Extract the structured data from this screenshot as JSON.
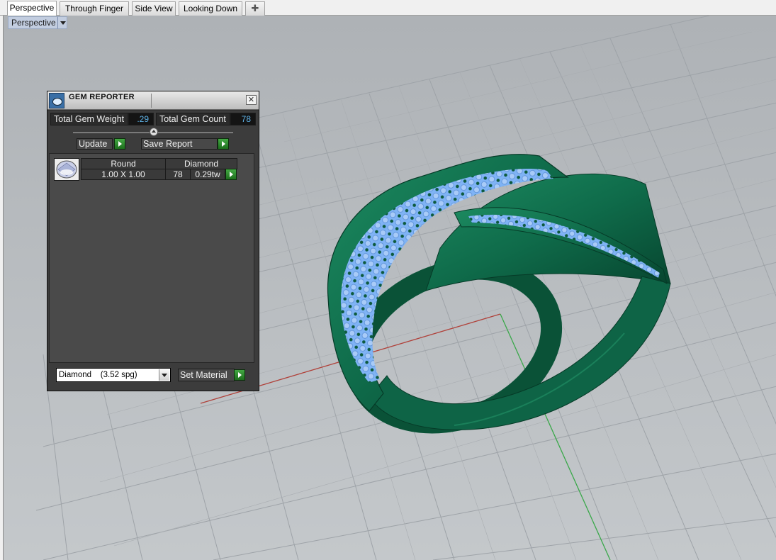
{
  "tabs": [
    {
      "label": "Perspective",
      "active": true
    },
    {
      "label": "Through Finger",
      "active": false
    },
    {
      "label": "Side View",
      "active": false
    },
    {
      "label": "Looking Down",
      "active": false
    }
  ],
  "add_tab_symbol": "✚",
  "viewport": {
    "label": "Perspective"
  },
  "gem_reporter": {
    "title": "GEM REPORTER",
    "close_symbol": "✕",
    "total_gem_weight_label": "Total Gem Weight",
    "total_gem_weight_value": ".29",
    "total_gem_count_label": "Total Gem Count",
    "total_gem_count_value": "78",
    "update_label": "Update",
    "save_report_label": "Save Report",
    "gems": [
      {
        "shape": "Round",
        "material": "Diamond",
        "size": "1.00 X 1.00",
        "count": "78",
        "weight": "0.29tw"
      }
    ],
    "material_select": "Diamond    (3.52 spg)",
    "set_material_label": "Set Material"
  },
  "colors": {
    "metal": "#0f6b4a",
    "stones": "#7fb3f5",
    "viewport_bg": "#b8bcc0",
    "x_axis": "#b0413a",
    "y_axis": "#3aa84a"
  }
}
